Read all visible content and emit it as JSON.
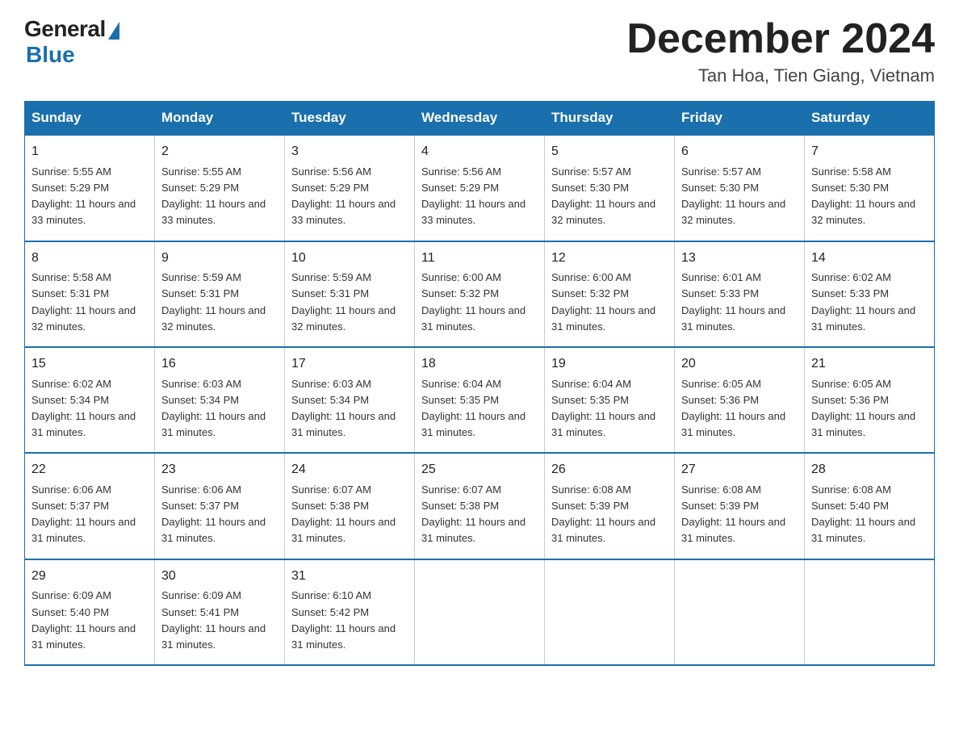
{
  "header": {
    "logo_general": "General",
    "logo_blue": "Blue",
    "month_title": "December 2024",
    "location": "Tan Hoa, Tien Giang, Vietnam"
  },
  "weekdays": [
    "Sunday",
    "Monday",
    "Tuesday",
    "Wednesday",
    "Thursday",
    "Friday",
    "Saturday"
  ],
  "weeks": [
    [
      {
        "day": "1",
        "sunrise": "Sunrise: 5:55 AM",
        "sunset": "Sunset: 5:29 PM",
        "daylight": "Daylight: 11 hours and 33 minutes."
      },
      {
        "day": "2",
        "sunrise": "Sunrise: 5:55 AM",
        "sunset": "Sunset: 5:29 PM",
        "daylight": "Daylight: 11 hours and 33 minutes."
      },
      {
        "day": "3",
        "sunrise": "Sunrise: 5:56 AM",
        "sunset": "Sunset: 5:29 PM",
        "daylight": "Daylight: 11 hours and 33 minutes."
      },
      {
        "day": "4",
        "sunrise": "Sunrise: 5:56 AM",
        "sunset": "Sunset: 5:29 PM",
        "daylight": "Daylight: 11 hours and 33 minutes."
      },
      {
        "day": "5",
        "sunrise": "Sunrise: 5:57 AM",
        "sunset": "Sunset: 5:30 PM",
        "daylight": "Daylight: 11 hours and 32 minutes."
      },
      {
        "day": "6",
        "sunrise": "Sunrise: 5:57 AM",
        "sunset": "Sunset: 5:30 PM",
        "daylight": "Daylight: 11 hours and 32 minutes."
      },
      {
        "day": "7",
        "sunrise": "Sunrise: 5:58 AM",
        "sunset": "Sunset: 5:30 PM",
        "daylight": "Daylight: 11 hours and 32 minutes."
      }
    ],
    [
      {
        "day": "8",
        "sunrise": "Sunrise: 5:58 AM",
        "sunset": "Sunset: 5:31 PM",
        "daylight": "Daylight: 11 hours and 32 minutes."
      },
      {
        "day": "9",
        "sunrise": "Sunrise: 5:59 AM",
        "sunset": "Sunset: 5:31 PM",
        "daylight": "Daylight: 11 hours and 32 minutes."
      },
      {
        "day": "10",
        "sunrise": "Sunrise: 5:59 AM",
        "sunset": "Sunset: 5:31 PM",
        "daylight": "Daylight: 11 hours and 32 minutes."
      },
      {
        "day": "11",
        "sunrise": "Sunrise: 6:00 AM",
        "sunset": "Sunset: 5:32 PM",
        "daylight": "Daylight: 11 hours and 31 minutes."
      },
      {
        "day": "12",
        "sunrise": "Sunrise: 6:00 AM",
        "sunset": "Sunset: 5:32 PM",
        "daylight": "Daylight: 11 hours and 31 minutes."
      },
      {
        "day": "13",
        "sunrise": "Sunrise: 6:01 AM",
        "sunset": "Sunset: 5:33 PM",
        "daylight": "Daylight: 11 hours and 31 minutes."
      },
      {
        "day": "14",
        "sunrise": "Sunrise: 6:02 AM",
        "sunset": "Sunset: 5:33 PM",
        "daylight": "Daylight: 11 hours and 31 minutes."
      }
    ],
    [
      {
        "day": "15",
        "sunrise": "Sunrise: 6:02 AM",
        "sunset": "Sunset: 5:34 PM",
        "daylight": "Daylight: 11 hours and 31 minutes."
      },
      {
        "day": "16",
        "sunrise": "Sunrise: 6:03 AM",
        "sunset": "Sunset: 5:34 PM",
        "daylight": "Daylight: 11 hours and 31 minutes."
      },
      {
        "day": "17",
        "sunrise": "Sunrise: 6:03 AM",
        "sunset": "Sunset: 5:34 PM",
        "daylight": "Daylight: 11 hours and 31 minutes."
      },
      {
        "day": "18",
        "sunrise": "Sunrise: 6:04 AM",
        "sunset": "Sunset: 5:35 PM",
        "daylight": "Daylight: 11 hours and 31 minutes."
      },
      {
        "day": "19",
        "sunrise": "Sunrise: 6:04 AM",
        "sunset": "Sunset: 5:35 PM",
        "daylight": "Daylight: 11 hours and 31 minutes."
      },
      {
        "day": "20",
        "sunrise": "Sunrise: 6:05 AM",
        "sunset": "Sunset: 5:36 PM",
        "daylight": "Daylight: 11 hours and 31 minutes."
      },
      {
        "day": "21",
        "sunrise": "Sunrise: 6:05 AM",
        "sunset": "Sunset: 5:36 PM",
        "daylight": "Daylight: 11 hours and 31 minutes."
      }
    ],
    [
      {
        "day": "22",
        "sunrise": "Sunrise: 6:06 AM",
        "sunset": "Sunset: 5:37 PM",
        "daylight": "Daylight: 11 hours and 31 minutes."
      },
      {
        "day": "23",
        "sunrise": "Sunrise: 6:06 AM",
        "sunset": "Sunset: 5:37 PM",
        "daylight": "Daylight: 11 hours and 31 minutes."
      },
      {
        "day": "24",
        "sunrise": "Sunrise: 6:07 AM",
        "sunset": "Sunset: 5:38 PM",
        "daylight": "Daylight: 11 hours and 31 minutes."
      },
      {
        "day": "25",
        "sunrise": "Sunrise: 6:07 AM",
        "sunset": "Sunset: 5:38 PM",
        "daylight": "Daylight: 11 hours and 31 minutes."
      },
      {
        "day": "26",
        "sunrise": "Sunrise: 6:08 AM",
        "sunset": "Sunset: 5:39 PM",
        "daylight": "Daylight: 11 hours and 31 minutes."
      },
      {
        "day": "27",
        "sunrise": "Sunrise: 6:08 AM",
        "sunset": "Sunset: 5:39 PM",
        "daylight": "Daylight: 11 hours and 31 minutes."
      },
      {
        "day": "28",
        "sunrise": "Sunrise: 6:08 AM",
        "sunset": "Sunset: 5:40 PM",
        "daylight": "Daylight: 11 hours and 31 minutes."
      }
    ],
    [
      {
        "day": "29",
        "sunrise": "Sunrise: 6:09 AM",
        "sunset": "Sunset: 5:40 PM",
        "daylight": "Daylight: 11 hours and 31 minutes."
      },
      {
        "day": "30",
        "sunrise": "Sunrise: 6:09 AM",
        "sunset": "Sunset: 5:41 PM",
        "daylight": "Daylight: 11 hours and 31 minutes."
      },
      {
        "day": "31",
        "sunrise": "Sunrise: 6:10 AM",
        "sunset": "Sunset: 5:42 PM",
        "daylight": "Daylight: 11 hours and 31 minutes."
      },
      null,
      null,
      null,
      null
    ]
  ]
}
